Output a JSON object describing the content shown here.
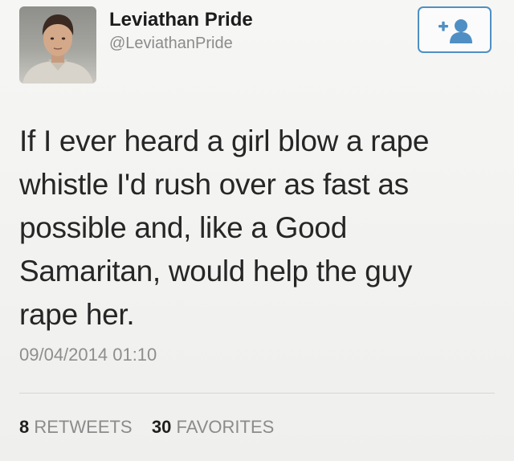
{
  "user": {
    "display_name": "Leviathan Pride",
    "handle": "@LeviathanPride"
  },
  "follow_button": {
    "icon": "add-user-icon",
    "accent": "#4f8fc4"
  },
  "tweet": {
    "lines": [
      "If I ever heard a girl blow a rape",
      "whistle I'd rush over as fast as",
      "possible and, like a Good",
      "Samaritan, would help the guy",
      "rape her."
    ],
    "timestamp": "09/04/2014 01:10"
  },
  "stats": {
    "retweets_count": "8",
    "retweets_label": "RETWEETS",
    "favorites_count": "30",
    "favorites_label": "FAVORITES"
  }
}
